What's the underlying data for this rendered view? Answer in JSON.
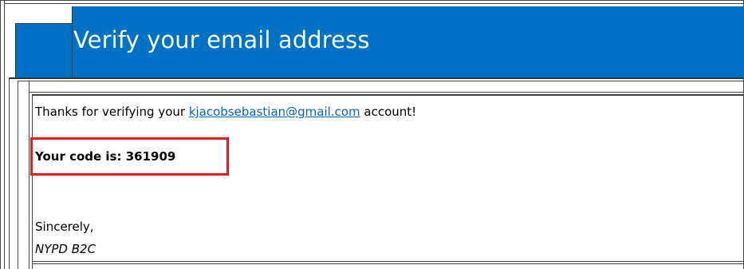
{
  "header": {
    "title": "Verify your email address",
    "background_color": "#0072c6"
  },
  "message": {
    "thanks_prefix": "Thanks for verifying your ",
    "email": "kjacobsebastian@gmail.com",
    "thanks_suffix": " account!",
    "code_line": "Your code is: 361909",
    "closing": "Sincerely,",
    "signature": "NYPD B2C"
  },
  "highlight": {
    "color": "#e02020"
  }
}
